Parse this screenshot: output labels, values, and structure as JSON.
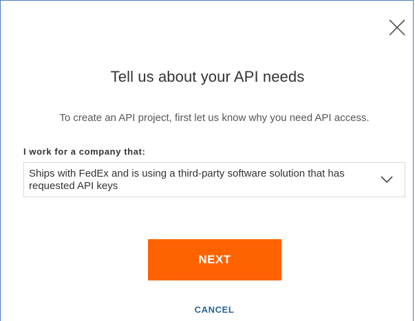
{
  "dialog": {
    "title": "Tell us about your API needs",
    "subtitle": "To create an API project, first let us know why you need API access.",
    "close_icon": "close-icon"
  },
  "form": {
    "field_label": "I work for a company that:",
    "selected_value": "Ships with FedEx and is using a third-party software solution that has requested API keys",
    "dropdown_icon": "chevron-down-icon"
  },
  "actions": {
    "next_label": "NEXT",
    "cancel_label": "CANCEL"
  },
  "colors": {
    "primary_button": "#ff6200",
    "cancel_link": "#2a6496",
    "modal_border": "#4a7cc9"
  }
}
